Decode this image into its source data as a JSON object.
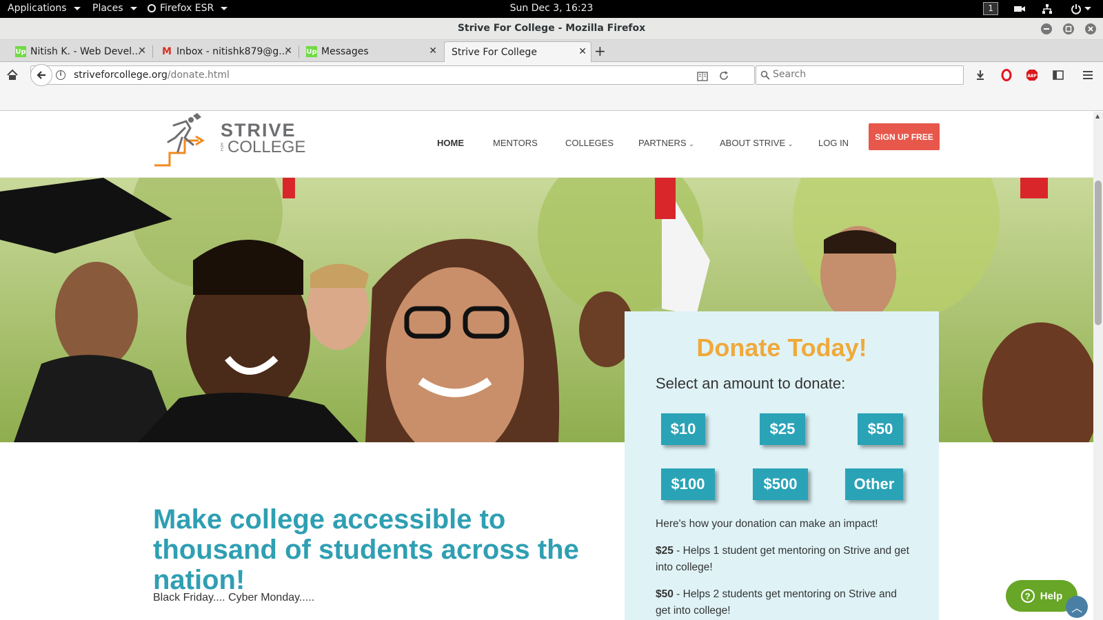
{
  "desktop": {
    "applications_label": "Applications",
    "places_label": "Places",
    "firefox_label": "Firefox ESR",
    "clock": "Sun Dec  3, 16:23",
    "workspace": "1"
  },
  "window": {
    "title": "Strive For College - Mozilla Firefox"
  },
  "tabs": [
    {
      "label": "Nitish K. - Web Devel...",
      "favicon": "upwork-icon"
    },
    {
      "label": "Inbox - nitishk879@g...",
      "favicon": "gmail-icon"
    },
    {
      "label": "Messages",
      "favicon": "upwork-icon"
    },
    {
      "label": "Strive For College",
      "favicon": "none",
      "active": true
    }
  ],
  "navbar": {
    "url_domain": "striveforcollege.org",
    "url_path": "/donate.html",
    "search_placeholder": "Search"
  },
  "site": {
    "logo_word1": "STRIVE",
    "logo_for": "FOR",
    "logo_word2": "COLLEGE",
    "nav": [
      "HOME",
      "MENTORS",
      "COLLEGES",
      "PARTNERS",
      "ABOUT STRIVE",
      "LOG IN"
    ],
    "signup_label": "SIGN UP FREE",
    "headline": "Make college accessible to thousand of students across the nation!",
    "subline": "Black Friday.... Cyber Monday.....",
    "donate": {
      "title": "Donate Today!",
      "subtitle": "Select an amount to donate:",
      "amounts": [
        "$10",
        "$25",
        "$50",
        "$100",
        "$500",
        "Other"
      ],
      "impact_intro": "Here's how your donation can make an impact!",
      "impact_items": [
        {
          "amount": "$25",
          "text": " - Helps 1 student get mentoring on Strive and get into college!"
        },
        {
          "amount": "$50",
          "text": " - Helps 2 students get mentoring on Strive and get into college!"
        }
      ]
    },
    "help_label": "Help",
    "colors": {
      "accent_teal": "#2aa3b7",
      "headline_teal": "#2f9fb3",
      "donate_orange": "#f0a93b",
      "signup_red": "#e8574b",
      "help_green": "#67a627",
      "panel_bg": "#dff3f7"
    }
  }
}
